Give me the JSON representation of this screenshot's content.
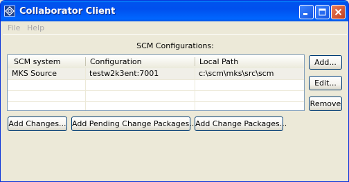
{
  "window": {
    "title": "Collaborator Client"
  },
  "menu": {
    "items": [
      "File",
      "Help"
    ]
  },
  "section_label": "SCM Configurations:",
  "table": {
    "columns": [
      "SCM system",
      "Configuration",
      "Local Path"
    ],
    "rows": [
      [
        "MKS Source",
        "testw2k3ent:7001",
        "c:\\scm\\mks\\src\\scm"
      ]
    ]
  },
  "side_buttons": {
    "add": "Add...",
    "edit": "Edit...",
    "remove": "Remove"
  },
  "bottom_buttons": {
    "add_changes": "Add Changes...",
    "add_pending": "Add Pending Change Packages...",
    "add_change_packages": "Add Change Packages..."
  }
}
